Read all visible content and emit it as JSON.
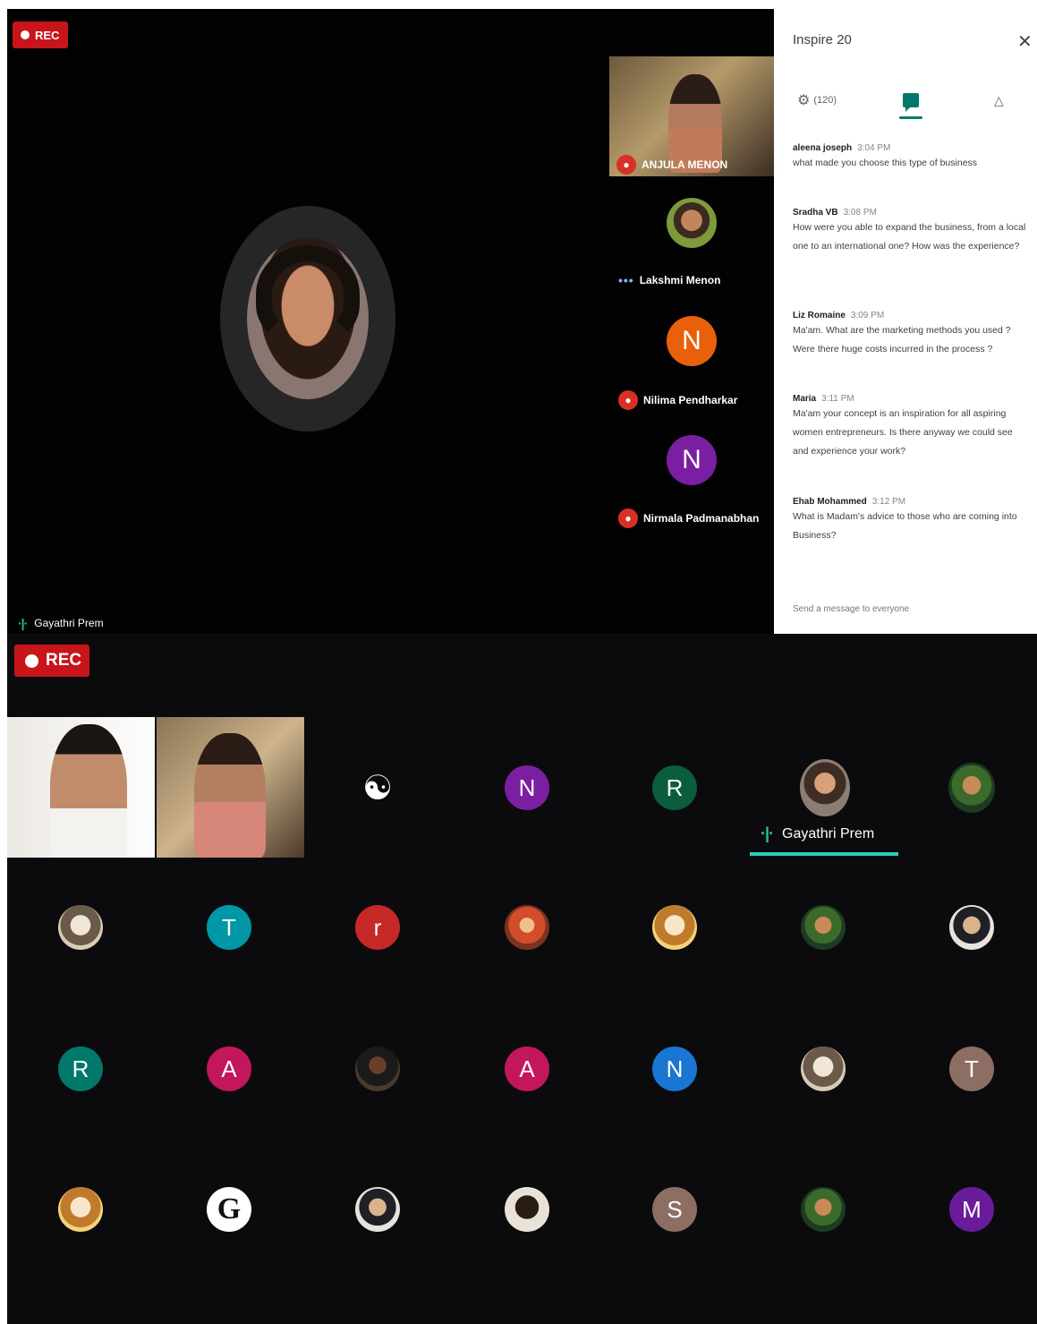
{
  "colors": {
    "recording": "#c7151a",
    "accent_teal": "#00796b",
    "speaking_bar": "#27d3b4",
    "mic_off": "#d93025"
  },
  "top": {
    "rec_label": "REC",
    "stage_speaker": "Gayathri Prem",
    "strip": [
      {
        "name": "ANJULA MENON",
        "type": "video",
        "mic": "off"
      },
      {
        "name": "Lakshmi Menon",
        "type": "photo",
        "mic": "speaking-dots"
      },
      {
        "name": "Nilima Pendharkar",
        "type": "letter",
        "letter": "N",
        "color": "#e8610a",
        "mic": "off"
      },
      {
        "name": "Nirmala Padmanabhan",
        "type": "letter",
        "letter": "N",
        "color": "#7b1fa2",
        "mic": "off"
      }
    ],
    "chat": {
      "title": "Inspire 20",
      "close_icon": "close-icon",
      "people_count": "(120)",
      "tabs": [
        "people-icon",
        "chat-icon",
        "activities-icon"
      ],
      "messages": [
        {
          "author": "aleena joseph",
          "time": "3:04 PM",
          "text": "what made you choose this type of business"
        },
        {
          "author": "Sradha VB",
          "time": "3:08 PM",
          "text": "How were you able to expand the business, from a local one to an international one? How was the experience?"
        },
        {
          "author": "Liz Romaine",
          "time": "3:09 PM",
          "text": "Ma'am. What are the marketing methods you used ? Were there huge costs incurred in the process ?"
        },
        {
          "author": "Maria",
          "time": "3:11 PM",
          "text": "Ma'am your concept is an inspiration for all aspiring women entrepreneurs. Is there anyway we could see and experience your work?"
        },
        {
          "author": "Ehab Mohammed",
          "time": "3:12 PM",
          "text": "What is Madam's advice to those who are coming into Business?"
        }
      ],
      "input_placeholder": "Send a message to everyone"
    }
  },
  "bottom": {
    "rec_label": "REC",
    "active_speaker": "Gayathri Prem",
    "grid": [
      {
        "kind": "video"
      },
      {
        "kind": "video"
      },
      {
        "kind": "icon",
        "icon": "yin-yang-icon"
      },
      {
        "kind": "letter",
        "letter": "N",
        "color": "#7b1fa2"
      },
      {
        "kind": "letter",
        "letter": "R",
        "color": "#0b5d3d"
      },
      {
        "kind": "photo"
      },
      {
        "kind": "photo"
      },
      {
        "kind": "photo"
      },
      {
        "kind": "letter",
        "letter": "T",
        "color": "#0097a7"
      },
      {
        "kind": "letter",
        "letter": "r",
        "color": "#c62828"
      },
      {
        "kind": "photo"
      },
      {
        "kind": "photo"
      },
      {
        "kind": "photo"
      },
      {
        "kind": "photo"
      },
      {
        "kind": "letter",
        "letter": "R",
        "color": "#00796b"
      },
      {
        "kind": "letter",
        "letter": "A",
        "color": "#c2185b"
      },
      {
        "kind": "photo"
      },
      {
        "kind": "letter",
        "letter": "A",
        "color": "#c2185b"
      },
      {
        "kind": "letter",
        "letter": "N",
        "color": "#1976d2"
      },
      {
        "kind": "photo"
      },
      {
        "kind": "letter",
        "letter": "T",
        "color": "#8d6e63"
      },
      {
        "kind": "photo"
      },
      {
        "kind": "logo",
        "letter": "G"
      },
      {
        "kind": "photo"
      },
      {
        "kind": "photo"
      },
      {
        "kind": "letter",
        "letter": "S",
        "color": "#8d6e63"
      },
      {
        "kind": "photo"
      },
      {
        "kind": "letter",
        "letter": "M",
        "color": "#6a1b9a"
      }
    ]
  }
}
